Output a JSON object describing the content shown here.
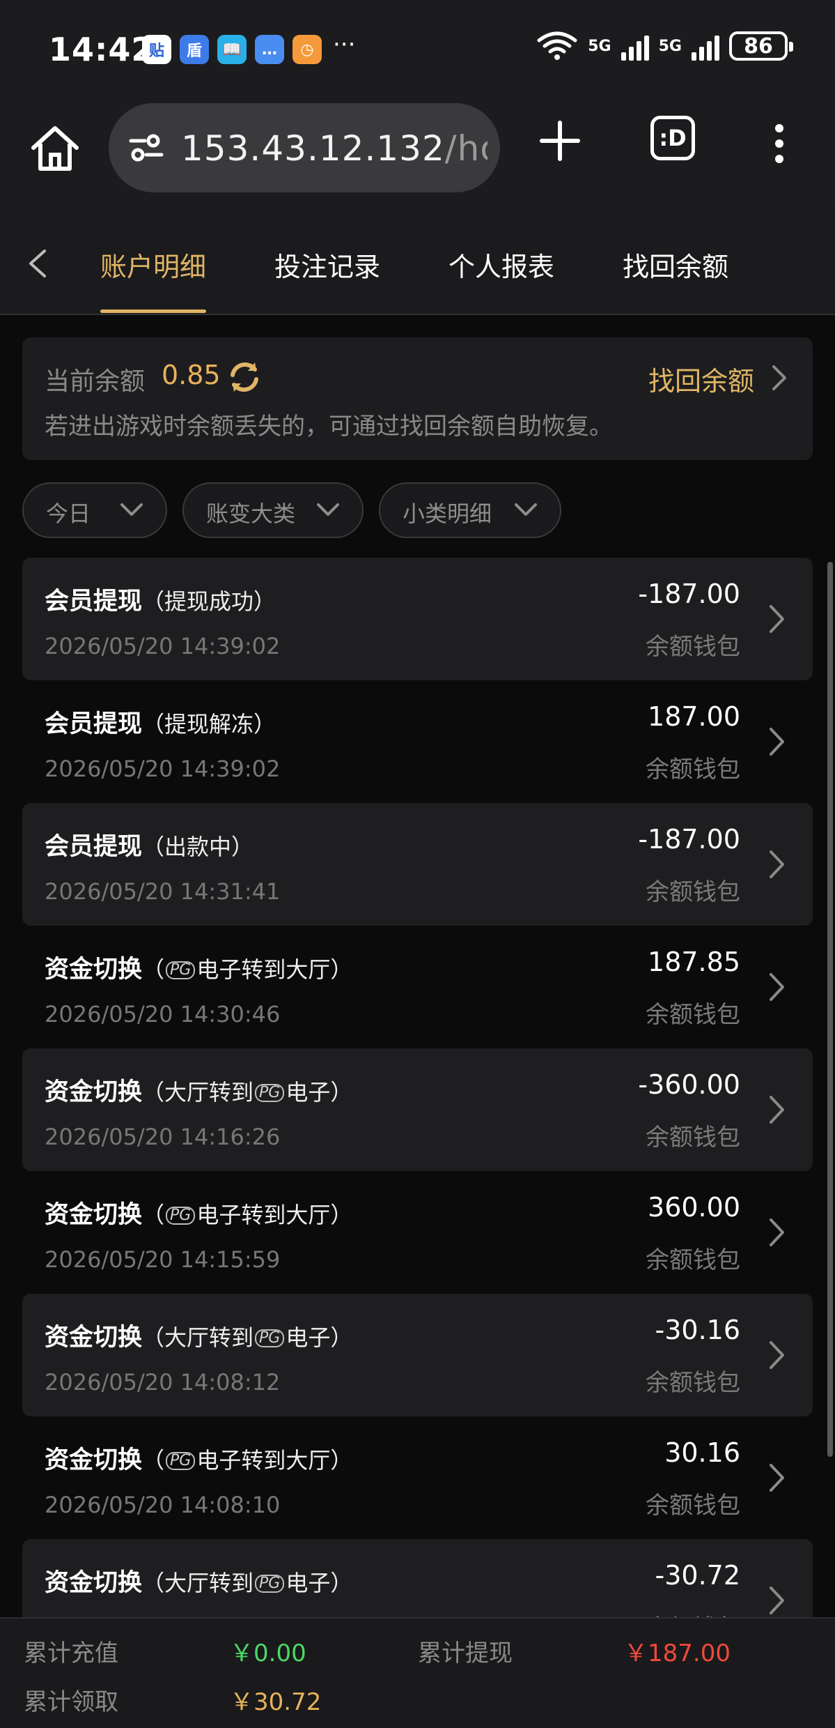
{
  "status_bar": {
    "time": "14:42",
    "app_icons": [
      {
        "icon": "tieba-icon",
        "glyph": "贴",
        "color": "#ffffff",
        "text_color": "#2a62d8"
      },
      {
        "icon": "shield-app-icon",
        "glyph": "盾",
        "color": "#3d7be8",
        "text_color": "#ffffff"
      },
      {
        "icon": "book-app-icon",
        "glyph": "📖",
        "color": "#2ab0e8",
        "text_color": "#ffffff"
      },
      {
        "icon": "chat-app-icon",
        "glyph": "…",
        "color": "#4a8df0",
        "text_color": "#ffffff"
      },
      {
        "icon": "clock-app-icon",
        "glyph": "◷",
        "color": "#f59a3a",
        "text_color": "#ffffff"
      }
    ],
    "more": "···",
    "network_1": "5G",
    "network_2": "5G",
    "battery": "86"
  },
  "browser": {
    "url_main": "153.43.12.132",
    "url_rest": "/hor"
  },
  "nav": {
    "tabs": [
      {
        "label": "账户明细",
        "active": true
      },
      {
        "label": "投注记录",
        "active": false
      },
      {
        "label": "个人报表",
        "active": false
      },
      {
        "label": "找回余额",
        "active": false
      }
    ]
  },
  "balance": {
    "label": "当前余额",
    "value": "0.85",
    "recover_label": "找回余额",
    "hint": "若进出游戏时余额丢失的，可通过找回余额自助恢复。"
  },
  "filters": [
    {
      "label": "今日"
    },
    {
      "label": "账变大类"
    },
    {
      "label": "小类明细"
    }
  ],
  "records": [
    {
      "title": "会员提现",
      "sub_pre": "（提现成功）",
      "pg": "",
      "sub_post": "",
      "time": "2026/05/20 14:39:02",
      "amount": "-187.00",
      "wallet": "余额钱包"
    },
    {
      "title": "会员提现",
      "sub_pre": "（提现解冻）",
      "pg": "",
      "sub_post": "",
      "time": "2026/05/20 14:39:02",
      "amount": "187.00",
      "wallet": "余额钱包"
    },
    {
      "title": "会员提现",
      "sub_pre": "（出款中）",
      "pg": "",
      "sub_post": "",
      "time": "2026/05/20 14:31:41",
      "amount": "-187.00",
      "wallet": "余额钱包"
    },
    {
      "title": "资金切换",
      "sub_pre": "（",
      "pg": "PG",
      "sub_post": "电子转到大厅）",
      "time": "2026/05/20 14:30:46",
      "amount": "187.85",
      "wallet": "余额钱包"
    },
    {
      "title": "资金切换",
      "sub_pre": "（大厅转到",
      "pg": "PG",
      "sub_post": "电子）",
      "time": "2026/05/20 14:16:26",
      "amount": "-360.00",
      "wallet": "余额钱包"
    },
    {
      "title": "资金切换",
      "sub_pre": "（",
      "pg": "PG",
      "sub_post": "电子转到大厅）",
      "time": "2026/05/20 14:15:59",
      "amount": "360.00",
      "wallet": "余额钱包"
    },
    {
      "title": "资金切换",
      "sub_pre": "（大厅转到",
      "pg": "PG",
      "sub_post": "电子）",
      "time": "2026/05/20 14:08:12",
      "amount": "-30.16",
      "wallet": "余额钱包"
    },
    {
      "title": "资金切换",
      "sub_pre": "（",
      "pg": "PG",
      "sub_post": "电子转到大厅）",
      "time": "2026/05/20 14:08:10",
      "amount": "30.16",
      "wallet": "余额钱包"
    },
    {
      "title": "资金切换",
      "sub_pre": "（大厅转到",
      "pg": "PG",
      "sub_post": "电子）",
      "time": "",
      "amount": "-30.72",
      "wallet": "余额钱包"
    }
  ],
  "summary": {
    "recharge_label": "累计充值",
    "recharge_value": "￥0.00",
    "withdraw_label": "累计提现",
    "withdraw_value": "￥187.00",
    "claim_label": "累计领取",
    "claim_value": "￥30.72"
  },
  "colors": {
    "accent_gold": "#e0b565",
    "positive_green": "#4cd964",
    "negative_red": "#f04a3c"
  }
}
